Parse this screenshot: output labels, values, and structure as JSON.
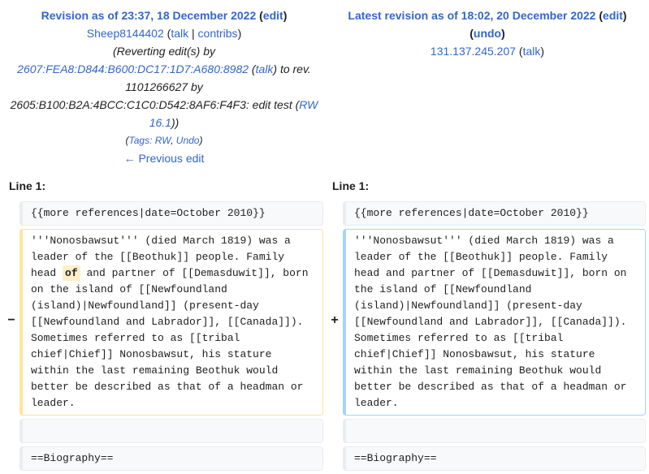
{
  "left": {
    "rev_title": "Revision as of 23:37, 18 December 2022",
    "edit": "edit",
    "user": "Sheep8144402",
    "talk": "talk",
    "contribs": "contribs",
    "summary_pre": "(Reverting edit(s) by",
    "ip_user": "2607:FEA8:D844:B600:DC17:1D7:A680:8982",
    "ip_talk": "talk",
    "summary_mid": "to rev. 1101266627 by",
    "summary_tail": "2605:B100:B2A:4BCC:C1C0:D542:8AF6:F4F3: edit test",
    "rw_link": "RW 16.1",
    "tags_label": "Tags:",
    "tag_rw": "RW",
    "tag_undo": "Undo",
    "prev_edit": "← Previous edit",
    "line_label": "Line 1:"
  },
  "right": {
    "rev_title": "Latest revision as of 18:02, 20 December 2022",
    "edit": "edit",
    "undo": "undo",
    "ip": "131.137.245.207",
    "talk": "talk",
    "line_label": "Line 1:"
  },
  "diff": {
    "context1": "{{more references|date=October 2010}}",
    "del_before": "'''Nonosbawsut''' (died March 1819) was a leader of the [[Beothuk]] people. Family head",
    "del_word": "of",
    "del_after": "and partner of [[Demasduwit]], born on the island of [[Newfoundland (island)|Newfoundland]] (present-day [[Newfoundland and Labrador]], [[Canada]]). Sometimes referred to as [[tribal chief|Chief]] Nonosbawsut, his stature within the last remaining Beothuk would better be described as that of a headman or leader.",
    "add_text": "'''Nonosbawsut''' (died March 1819) was a leader of the [[Beothuk]] people. Family head and partner of [[Demasduwit]], born on the island of [[Newfoundland (island)|Newfoundland]] (present-day [[Newfoundland and Labrador]], [[Canada]]). Sometimes referred to as [[tribal chief|Chief]] Nonosbawsut, his stature within the last remaining Beothuk would better be described as that of a headman or leader.",
    "context2": "",
    "context3": "==Biography==",
    "minus": "−",
    "plus": "+"
  }
}
